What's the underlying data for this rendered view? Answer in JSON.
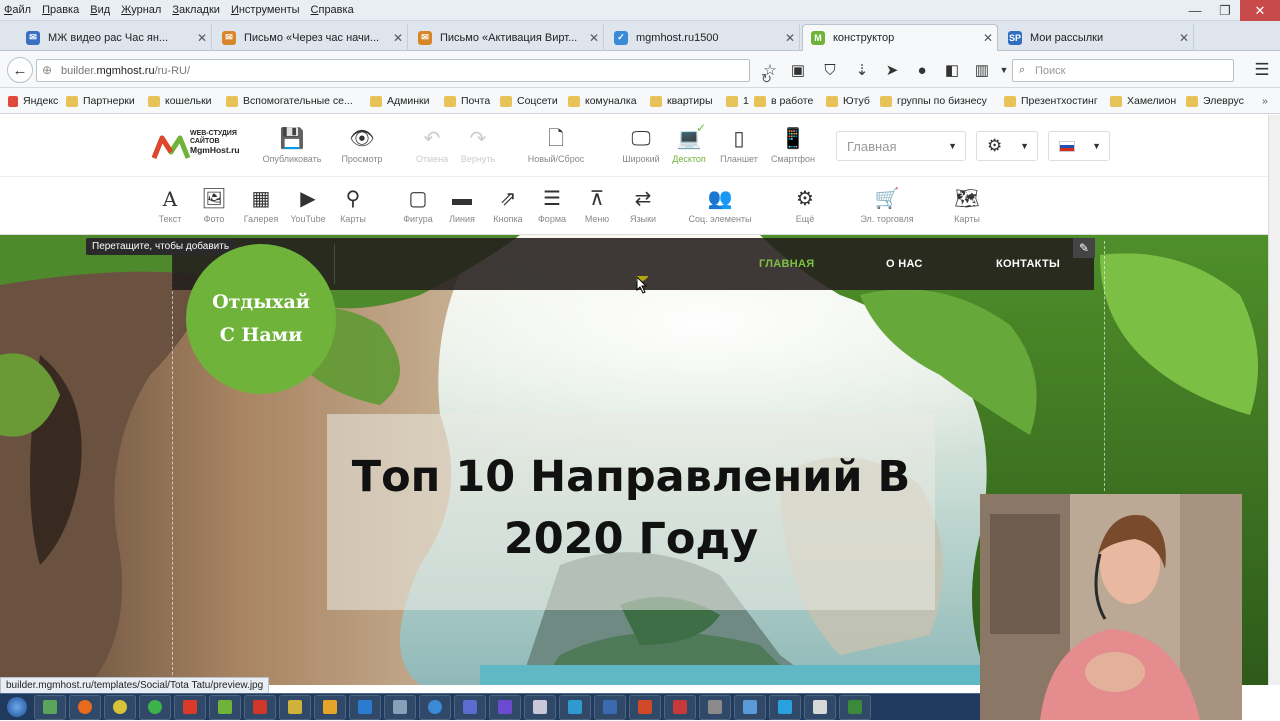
{
  "menubar": {
    "items": [
      "Файл",
      "Правка",
      "Вид",
      "Журнал",
      "Закладки",
      "Инструменты",
      "Справка"
    ]
  },
  "window_controls": {
    "minimize": "—",
    "maximize": "❐",
    "close": "✕"
  },
  "tabs": [
    {
      "label": "МЖ видео рас Час ян...",
      "favicon_color": "#3a6fc4"
    },
    {
      "label": "Письмо «Через час начи...",
      "favicon_color": "#d9862a"
    },
    {
      "label": "Письмо «Активация Вирт...",
      "favicon_color": "#d9862a"
    },
    {
      "label": "mgmhost.ru1500",
      "favicon_color": "#3a8ad6"
    },
    {
      "label": "конструктор",
      "favicon_color": "#6fb33a",
      "active": true
    },
    {
      "label": "Мои рассылки",
      "favicon_color": "#2f6dc0"
    }
  ],
  "newtab_label": "+",
  "url": {
    "prefix": "builder.",
    "domain": "mgmhost.ru",
    "path": "/ru-RU/"
  },
  "search_placeholder": "Поиск",
  "bookmarks": [
    "Яндекс",
    "Партнерки",
    "кошельки",
    "Вспомогательные се...",
    "Админки",
    "Почта",
    "Соцсети",
    "комуналка",
    "квартиры",
    "1",
    "в работе",
    "Ютуб",
    "группы по бизнесу",
    "Презентхостинг",
    "Хамелион",
    "Элеврус"
  ],
  "brand": {
    "line1": "WEB-СТУДИЯ",
    "line2": "САЙТОВ",
    "line3": "MgmHost.ru",
    "accent": "#6fb33a"
  },
  "top_tools": [
    {
      "icon": "save-icon",
      "glyph": "💾",
      "label": "Опубликовать"
    },
    {
      "icon": "eye-icon",
      "glyph": "👁",
      "label": "Просмотр"
    },
    {
      "icon": "undo-icon",
      "glyph": "↶",
      "label": "Отмена",
      "disabled": true
    },
    {
      "icon": "redo-icon",
      "glyph": "↷",
      "label": "Вернуть",
      "disabled": true
    },
    {
      "icon": "new-page-icon",
      "glyph": "🗋",
      "label": "Новый/Сброс"
    },
    {
      "icon": "wide-monitor-icon",
      "glyph": "🖵",
      "label": "Широкий"
    },
    {
      "icon": "laptop-icon",
      "glyph": "💻",
      "label": "Десктоп"
    },
    {
      "icon": "tablet-icon",
      "glyph": "▯",
      "label": "Планшет"
    },
    {
      "icon": "smartphone-icon",
      "glyph": "📱",
      "label": "Смартфон"
    }
  ],
  "page_select": "Главная",
  "widget_tools": [
    {
      "icon": "text-icon",
      "glyph": "A",
      "label": "Текст"
    },
    {
      "icon": "photo-icon",
      "glyph": "🖼",
      "label": "Фото"
    },
    {
      "icon": "gallery-icon",
      "glyph": "▦",
      "label": "Галерея"
    },
    {
      "icon": "youtube-icon",
      "glyph": "▶",
      "label": "YouTube"
    },
    {
      "icon": "map-pin-icon",
      "glyph": "⚲",
      "label": "Карты"
    },
    {
      "icon": "shape-icon",
      "glyph": "▢",
      "label": "Фигура"
    },
    {
      "icon": "line-icon",
      "glyph": "▬",
      "label": "Линия"
    },
    {
      "icon": "button-icon",
      "glyph": "⇗",
      "label": "Кнопка"
    },
    {
      "icon": "form-icon",
      "glyph": "☰",
      "label": "Форма"
    },
    {
      "icon": "menu-icon",
      "glyph": "⊼",
      "label": "Меню"
    },
    {
      "icon": "languages-icon",
      "glyph": "⇄",
      "label": "Языки"
    },
    {
      "icon": "social-icon",
      "glyph": "👥",
      "label": "Соц. элементы"
    },
    {
      "icon": "more-icon",
      "glyph": "⚙",
      "label": "Ещё"
    },
    {
      "icon": "cart-icon",
      "glyph": "🛒",
      "label": "Эл. торговля"
    },
    {
      "icon": "maps-icon",
      "glyph": "🗺",
      "label": "Карты"
    }
  ],
  "tooltip": "Перетащите, чтобы добавить",
  "site_nav": {
    "links": [
      "ГЛАВНАЯ",
      "О НАС",
      "КОНТАКТЫ"
    ],
    "active_color": "#7cc142"
  },
  "badge": {
    "line1": "Отдыхай",
    "line2": "С Нами"
  },
  "hero": {
    "line1": "Топ 10 Направлений В",
    "line2": "2020 Году"
  },
  "status_url": "builder.mgmhost.ru/templates/Social/Tota Tatu/preview.jpg"
}
